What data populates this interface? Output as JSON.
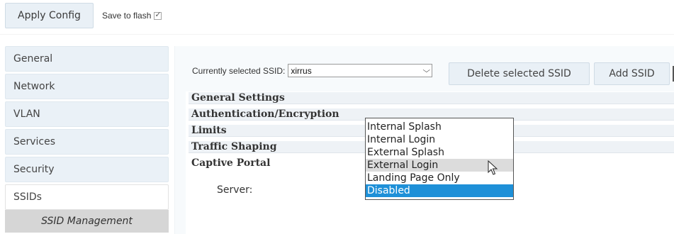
{
  "toolbar": {
    "apply_label": "Apply Config",
    "save_flash_label": "Save to flash",
    "save_flash_checked": true
  },
  "sidebar": {
    "items": [
      {
        "label": "General"
      },
      {
        "label": "Network"
      },
      {
        "label": "VLAN"
      },
      {
        "label": "Services"
      },
      {
        "label": "Security"
      },
      {
        "label": "SSIDs"
      }
    ],
    "active_item": "SSIDs",
    "sub_item": "SSID Management"
  },
  "ssid": {
    "label": "Currently selected SSID:",
    "selected_value": "xirrus",
    "delete_label": "Delete selected SSID",
    "add_label": "Add SSID"
  },
  "sections": [
    {
      "label": "General Settings"
    },
    {
      "label": "Authentication/Encryption"
    },
    {
      "label": "Limits"
    },
    {
      "label": "Traffic Shaping"
    },
    {
      "label": "Captive Portal"
    }
  ],
  "captive_portal": {
    "server_label": "Server:",
    "dropdown_options": [
      {
        "label": "Internal Splash"
      },
      {
        "label": "Internal Login"
      },
      {
        "label": "External Splash"
      },
      {
        "label": "External Login",
        "state": "hover"
      },
      {
        "label": "Landing Page Only"
      },
      {
        "label": "Disabled",
        "state": "selected"
      }
    ]
  },
  "colors": {
    "accent_selected": "#1e90d8",
    "button_bg": "#e9f0f6",
    "section_bg": "#eef2f6"
  },
  "icons": {
    "checkbox": "checkmark-icon",
    "select": "chevron-down-icon",
    "pointer": "mouse-cursor-icon"
  }
}
